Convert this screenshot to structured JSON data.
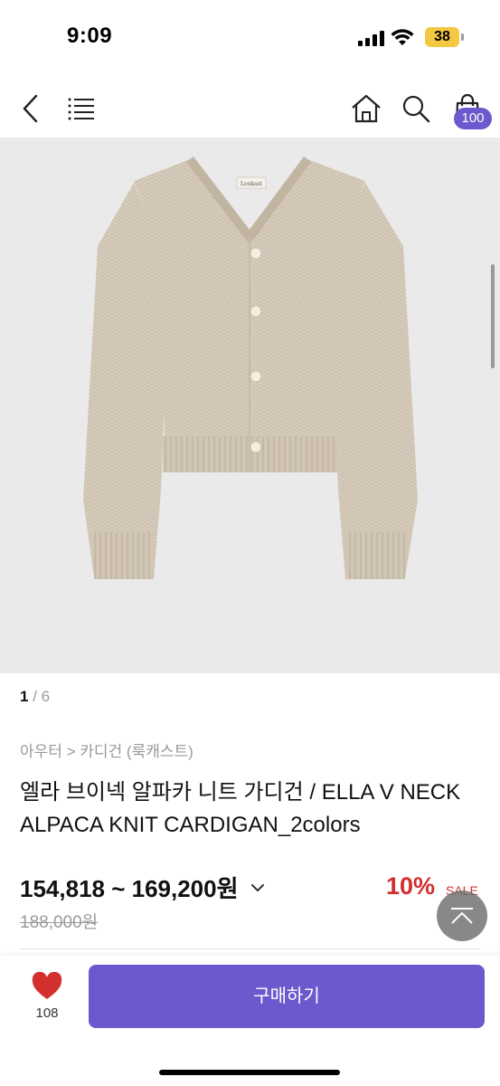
{
  "status_bar": {
    "time": "9:09",
    "battery": "38"
  },
  "nav": {
    "back_icon": "chevron-left-icon",
    "menu_icon": "menu-lines-icon",
    "home_icon": "home-icon",
    "search_icon": "search-icon",
    "cart_icon": "shopping-bag-icon",
    "cart_count": "100"
  },
  "product_image": {
    "brand_tag": "Lookast",
    "item_color": "#d7ccbd"
  },
  "pager": {
    "current": "1",
    "separator": " / ",
    "total": "6"
  },
  "breadcrumb": "아우터 > 카디건 (룩캐스트)",
  "title": "엘라 브이넥 알파카 니트 가디건 / ELLA V NECK ALPACA KNIT CARDIGAN_2colors",
  "price": {
    "range": "154,818 ~ 169,200원",
    "original": "188,000원",
    "discount": "10%",
    "sale_label": "SALE"
  },
  "bottom": {
    "like_count": "108",
    "buy_label": "구매하기"
  },
  "colors": {
    "accent": "#6a5acd",
    "sale": "#d32f2f",
    "muted": "#9a9a9a"
  }
}
